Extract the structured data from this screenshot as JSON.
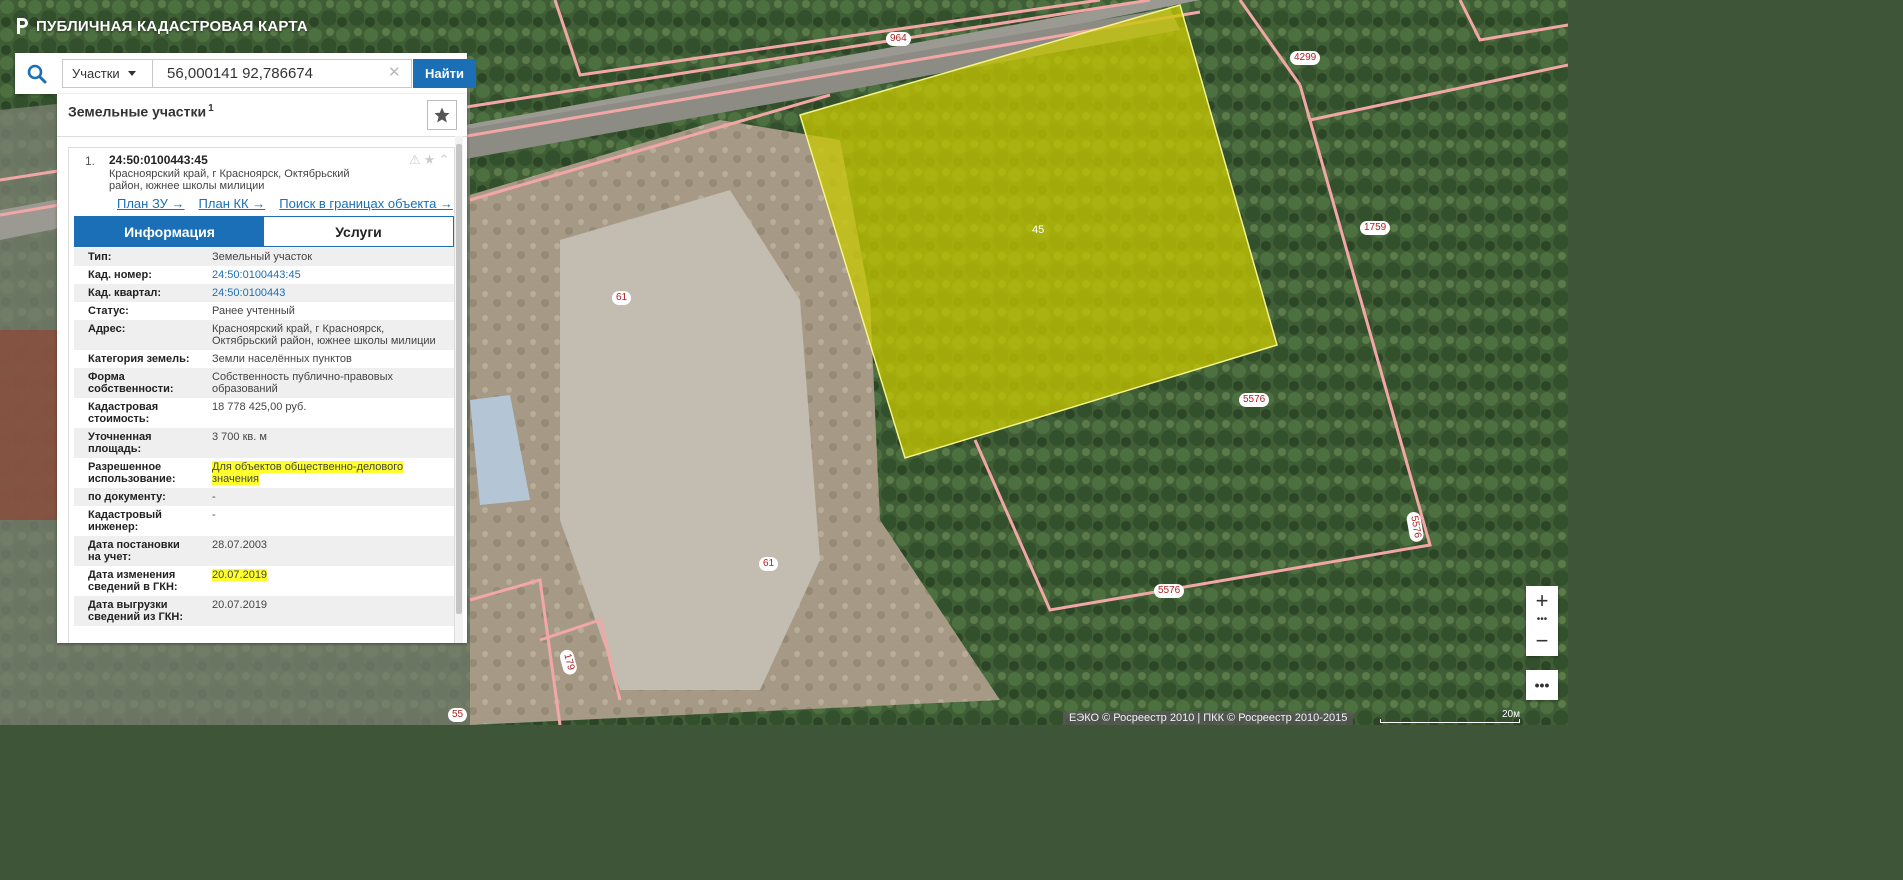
{
  "app": {
    "title": "ПУБЛИЧНАЯ КАДАСТРОВАЯ КАРТА"
  },
  "search": {
    "type_selected": "Участки",
    "query": "56,000141 92,786674",
    "clear_glyph": "✕",
    "find_label": "Найти",
    "search_icon": "search-icon"
  },
  "panel": {
    "title": "Земельные участки",
    "count": "1",
    "result": {
      "index": "1.",
      "cad_number": "24:50:0100443:45",
      "address": "Красноярский край, г Красноярск, Октябрьский район, южнее школы милиции",
      "links": {
        "plan_zu": "План ЗУ →",
        "plan_kk": "План КК →",
        "search_in_bounds": "Поиск в границах объекта →"
      },
      "tabs": {
        "info": "Информация",
        "services": "Услуги"
      },
      "fields": [
        {
          "key": "Тип:",
          "value": "Земельный участок"
        },
        {
          "key": "Кад. номер:",
          "value": "24:50:0100443:45"
        },
        {
          "key": "Кад. квартал:",
          "value": "24:50:0100443"
        },
        {
          "key": "Статус:",
          "value": "Ранее учтенный"
        },
        {
          "key": "Адрес:",
          "value": "Красноярский край, г Красноярск, Октябрьский район, южнее школы милиции"
        },
        {
          "key": "Категория земель:",
          "value": "Земли населённых пунктов"
        },
        {
          "key": "Форма собственности:",
          "value": "Собственность публично-правовых образований"
        },
        {
          "key": "Кадастровая стоимость:",
          "value": "18 778 425,00 руб."
        },
        {
          "key": "Уточненная площадь:",
          "value": "3 700 кв. м"
        },
        {
          "key": "Разрешенное использование:",
          "value": "Для объектов общественно-делового значения"
        },
        {
          "key": "по документу:",
          "value": "-"
        },
        {
          "key": "Кадастровый инженер:",
          "value": "-"
        },
        {
          "key": "Дата постановки на учет:",
          "value": "28.07.2003"
        },
        {
          "key": "Дата изменения сведений в ГКН:",
          "value": "20.07.2019"
        },
        {
          "key": "Дата выгрузки сведений из ГКН:",
          "value": "20.07.2019"
        }
      ]
    }
  },
  "map": {
    "highlight_color": "#c8c800",
    "boundary_color": "#f3a6a6",
    "plot_labels": [
      "964",
      "4299",
      "1759",
      "61",
      "5576",
      "5576",
      "5576",
      "61",
      "55",
      "179"
    ],
    "selected_label": "45"
  },
  "controls": {
    "zoom_in": "+",
    "zoom_out": "−",
    "more": "•••"
  },
  "footer": {
    "attribution": "ЕЭКО © Росреестр 2010 | ПКК © Росреестр 2010-2015",
    "scale_label": "20м"
  }
}
